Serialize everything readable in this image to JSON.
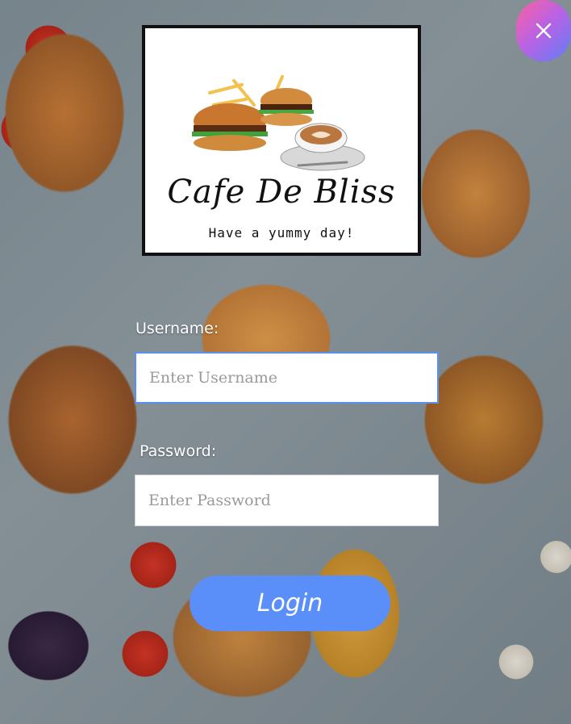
{
  "brand": {
    "name": "Cafe De Bliss",
    "tagline": "Have a yummy day!"
  },
  "form": {
    "username_label": "Username:",
    "username_placeholder": "Enter Username",
    "username_value": "",
    "password_label": "Password:",
    "password_placeholder": "Enter Password",
    "password_value": ""
  },
  "actions": {
    "login_label": "Login",
    "close_icon": "close-icon"
  },
  "colors": {
    "accent": "#5a8ef8",
    "close_gradient_start": "#ff5fa0",
    "close_gradient_end": "#5d7ff5"
  }
}
